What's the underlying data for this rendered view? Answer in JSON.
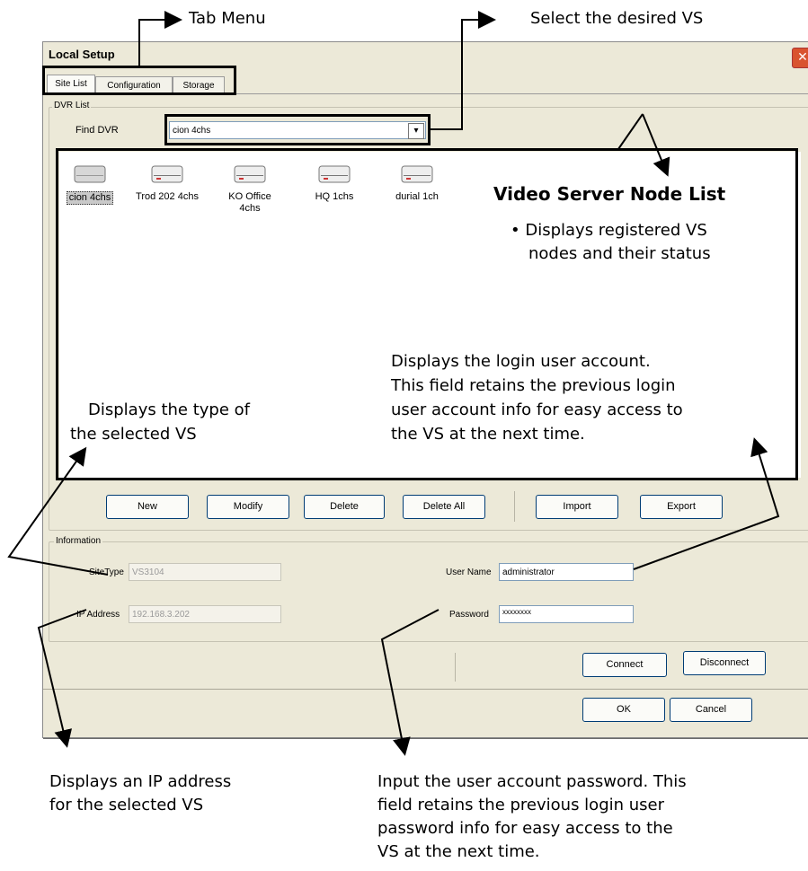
{
  "annotations": {
    "tab_menu": "Tab Menu",
    "select_vs": "Select the desired VS",
    "node_list_title": "Video Server Node List",
    "node_list_desc_1": "• Displays registered VS",
    "node_list_desc_2": "nodes and their status",
    "login_desc_1": "Displays the login user account.",
    "login_desc_2": "This field retains the previous login",
    "login_desc_3": "user account info for easy access to",
    "login_desc_4": "the VS at the next time.",
    "type_desc_1": "Displays the type of",
    "type_desc_2": "the selected VS",
    "ip_desc_1": "Displays an IP address",
    "ip_desc_2": "for the selected VS",
    "pw_desc_1": "Input the user account password. This",
    "pw_desc_2": "field retains the previous login user",
    "pw_desc_3": "password info for easy access to the",
    "pw_desc_4": "VS at the next time."
  },
  "window": {
    "title": "Local Setup",
    "close_glyph": "✕"
  },
  "tabs": [
    "Site List",
    "Configuration",
    "Storage"
  ],
  "dvr_list": {
    "group_label": "DVR List",
    "find_label": "Find DVR",
    "find_value": "cion 4chs",
    "dropdown_glyph": "▾"
  },
  "nodes": [
    {
      "label": "cion 4chs",
      "icon": "server-icon",
      "selected": true
    },
    {
      "label": "Trod 202 4chs",
      "icon": "server-icon"
    },
    {
      "label": "KO Office",
      "label2": "4chs",
      "icon": "server-icon"
    },
    {
      "label": "HQ 1chs",
      "icon": "server-icon"
    },
    {
      "label": "durial 1ch",
      "icon": "server-icon"
    }
  ],
  "buttons": {
    "new": "New",
    "modify": "Modify",
    "delete": "Delete",
    "delete_all": "Delete All",
    "import": "Import",
    "export": "Export",
    "connect": "Connect",
    "disconnect": "Disconnect",
    "ok": "OK",
    "cancel": "Cancel"
  },
  "information": {
    "group_label": "Information",
    "sitetype_label": "SiteType",
    "sitetype_value": "VS3104",
    "ip_label": "IP Address",
    "ip_value": "192.168.3.202",
    "username_label": "User Name",
    "username_value": "administrator",
    "password_label": "Password",
    "password_value": "xxxxxxxx"
  },
  "colors": {
    "dialog_bg": "#ece9d8",
    "close_red": "#d9532f",
    "highlight": "#000000"
  }
}
